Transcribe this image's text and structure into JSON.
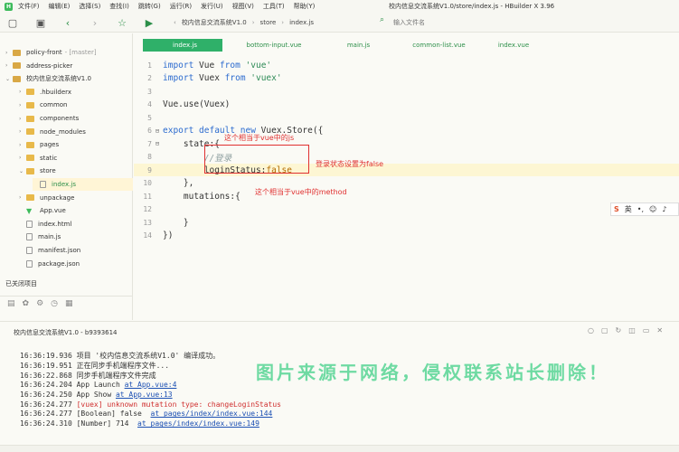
{
  "menu": {
    "items": [
      "文件(F)",
      "编辑(E)",
      "选择(S)",
      "查找(I)",
      "跳转(G)",
      "运行(R)",
      "发行(U)",
      "视图(V)",
      "工具(T)",
      "帮助(Y)"
    ],
    "window_title": "校内信息交流系统V1.0/store/index.js - HBuilder X 3.96"
  },
  "toolbar": {
    "breadcrumb": [
      "校内信息交流系统V1.0",
      "store",
      "index.js"
    ],
    "search_placeholder": "输入文件名"
  },
  "sidebar": {
    "items": [
      {
        "label": "policy-front",
        "extra": "- [master]",
        "type": "project",
        "arrow": "›",
        "indent": 0
      },
      {
        "label": "address-picker",
        "extra": "",
        "type": "project",
        "arrow": "›",
        "indent": 0
      },
      {
        "label": "校内信息交流系统V1.0",
        "extra": "",
        "type": "project",
        "arrow": "⌄",
        "indent": 0
      },
      {
        "label": ".hbuilderx",
        "extra": "",
        "type": "folder",
        "arrow": "›",
        "indent": 1
      },
      {
        "label": "common",
        "extra": "",
        "type": "folder",
        "arrow": "›",
        "indent": 1
      },
      {
        "label": "components",
        "extra": "",
        "type": "folder",
        "arrow": "›",
        "indent": 1
      },
      {
        "label": "node_modules",
        "extra": "",
        "type": "folder",
        "arrow": "›",
        "indent": 1
      },
      {
        "label": "pages",
        "extra": "",
        "type": "folder",
        "arrow": "›",
        "indent": 1
      },
      {
        "label": "static",
        "extra": "",
        "type": "folder",
        "arrow": "›",
        "indent": 1
      },
      {
        "label": "store",
        "extra": "",
        "type": "folder",
        "arrow": "⌄",
        "indent": 1
      },
      {
        "label": "index.js",
        "extra": "",
        "type": "file",
        "arrow": "",
        "indent": 2,
        "selected": true
      },
      {
        "label": "unpackage",
        "extra": "",
        "type": "folder",
        "arrow": "›",
        "indent": 1
      },
      {
        "label": "App.vue",
        "extra": "",
        "type": "vue",
        "arrow": "",
        "indent": 1
      },
      {
        "label": "index.html",
        "extra": "",
        "type": "file",
        "arrow": "",
        "indent": 1
      },
      {
        "label": "main.js",
        "extra": "",
        "type": "file",
        "arrow": "",
        "indent": 1
      },
      {
        "label": "manifest.json",
        "extra": "",
        "type": "file",
        "arrow": "",
        "indent": 1
      },
      {
        "label": "package.json",
        "extra": "",
        "type": "file",
        "arrow": "",
        "indent": 1
      }
    ],
    "closed_projects": "已关闭项目"
  },
  "tabs": [
    "index.js",
    "bottom-input.vue",
    "main.js",
    "common-list.vue",
    "index.vue"
  ],
  "code_lines": [
    {
      "n": "1",
      "fold": "",
      "parts": [
        [
          "kw",
          "import "
        ],
        [
          "plain",
          "Vue "
        ],
        [
          "kw",
          "from "
        ],
        [
          "str",
          "'vue'"
        ]
      ]
    },
    {
      "n": "2",
      "fold": "",
      "parts": [
        [
          "kw",
          "import "
        ],
        [
          "plain",
          "Vuex "
        ],
        [
          "kw",
          "from "
        ],
        [
          "str",
          "'vuex'"
        ]
      ]
    },
    {
      "n": "3",
      "fold": "",
      "parts": []
    },
    {
      "n": "4",
      "fold": "",
      "parts": [
        [
          "plain",
          "Vue."
        ],
        [
          "fn",
          "use"
        ],
        [
          "plain",
          "(Vuex)"
        ]
      ]
    },
    {
      "n": "5",
      "fold": "",
      "parts": []
    },
    {
      "n": "6",
      "fold": "⊟",
      "parts": [
        [
          "kw",
          "export default new "
        ],
        [
          "plain",
          "Vuex.Store({"
        ]
      ]
    },
    {
      "n": "7",
      "fold": "⊟",
      "parts": [
        [
          "plain",
          "    state:{"
        ]
      ]
    },
    {
      "n": "8",
      "fold": "",
      "parts": [
        [
          "cmt",
          "        //登录"
        ]
      ]
    },
    {
      "n": "9",
      "fold": "",
      "parts": [
        [
          "plain",
          "        loginStatus:"
        ],
        [
          "bool",
          "false"
        ]
      ],
      "current": true
    },
    {
      "n": "10",
      "fold": "",
      "parts": [
        [
          "plain",
          "    },"
        ]
      ]
    },
    {
      "n": "11",
      "fold": "",
      "parts": [
        [
          "plain",
          "    mutations:{"
        ]
      ]
    },
    {
      "n": "12",
      "fold": "",
      "parts": []
    },
    {
      "n": "13",
      "fold": "",
      "parts": [
        [
          "plain",
          "    }"
        ]
      ]
    },
    {
      "n": "14",
      "fold": "",
      "parts": [
        [
          "plain",
          "})"
        ]
      ]
    }
  ],
  "annotations": {
    "state": "这个相当于vue中的js",
    "login": "登录状态设置为false",
    "mutations": "这个相当于vue中的method"
  },
  "ime": {
    "logo": "S",
    "mode": "英"
  },
  "console": {
    "title": "校内信息交流系统V1.0 - b9393614",
    "lines": [
      {
        "time": "16:36:19.936",
        "text": " 项目 '校内信息交流系统V1.0' 编译成功。",
        "link": "",
        "warn": false
      },
      {
        "time": "16:36:19.951",
        "text": " 正在同步手机端程序文件...",
        "link": "",
        "warn": false
      },
      {
        "time": "16:36:22.868",
        "text": " 同步手机端程序文件完成",
        "link": "",
        "warn": false
      },
      {
        "time": "16:36:24.204",
        "text": " App Launch ",
        "link": "at App.vue:4",
        "warn": false
      },
      {
        "time": "16:36:24.250",
        "text": " App Show ",
        "link": "at App.vue:13",
        "warn": false
      },
      {
        "time": "16:36:24.277",
        "text": " [vuex] unknown mutation type: changeLoginStatus",
        "link": "",
        "warn": true
      },
      {
        "time": "16:36:24.277",
        "text": " [Boolean] false  ",
        "link": "at pages/index/index.vue:144",
        "warn": false
      },
      {
        "time": "16:36:24.310",
        "text": " [Number] 714  ",
        "link": "at pages/index/index.vue:149",
        "warn": false
      }
    ]
  },
  "watermark": "图片来源于网络，侵权联系站长删除！"
}
